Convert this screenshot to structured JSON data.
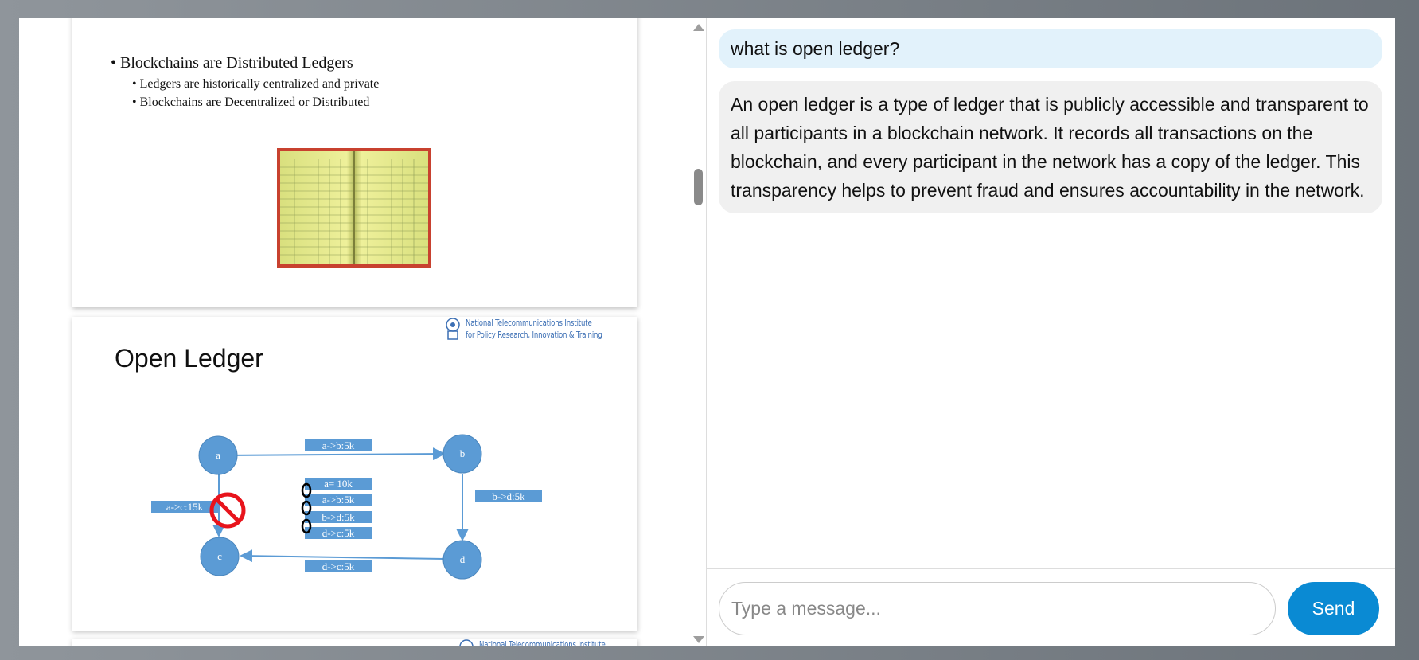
{
  "slides": {
    "slide1": {
      "bullet_main": "Blockchains are Distributed Ledgers",
      "sub_bullets": [
        "Ledgers are historically centralized and private",
        "Blockchains are Decentralized or Distributed"
      ],
      "image": "ledger-book"
    },
    "slide2": {
      "title": "Open Ledger",
      "logo_line1": "National Telecommunications Institute",
      "logo_line2": "for Policy Research, Innovation & Training",
      "nodes": [
        "a",
        "b",
        "c",
        "d"
      ],
      "edge_labels": {
        "ab": "a->b:5k",
        "bd": "b->d:5k",
        "dc": "d->c:5k",
        "ac": "a->c:15k"
      },
      "ledger_entries": [
        "a= 10k",
        "a->b:5k",
        "b->d:5k",
        "d->c:5k"
      ]
    },
    "slide3": {
      "logo_line1": "National Telecommunications Institute"
    }
  },
  "chat": {
    "user_message": "what is open ledger?",
    "bot_message": "An open ledger is a type of ledger that is publicly accessible and transparent to all participants in a blockchain network. It records all transactions on the blockchain, and every participant in the network has a copy of the ledger. This transparency helps to prevent fraud and ensures accountability in the network."
  },
  "composer": {
    "placeholder": "Type a message...",
    "send_label": "Send"
  },
  "colors": {
    "node_fill": "#5b9bd5",
    "send_button": "#0a8ad3",
    "user_bubble": "#e2f2fb",
    "bot_bubble": "#f0f0f0",
    "prohibit": "#e8141c"
  }
}
